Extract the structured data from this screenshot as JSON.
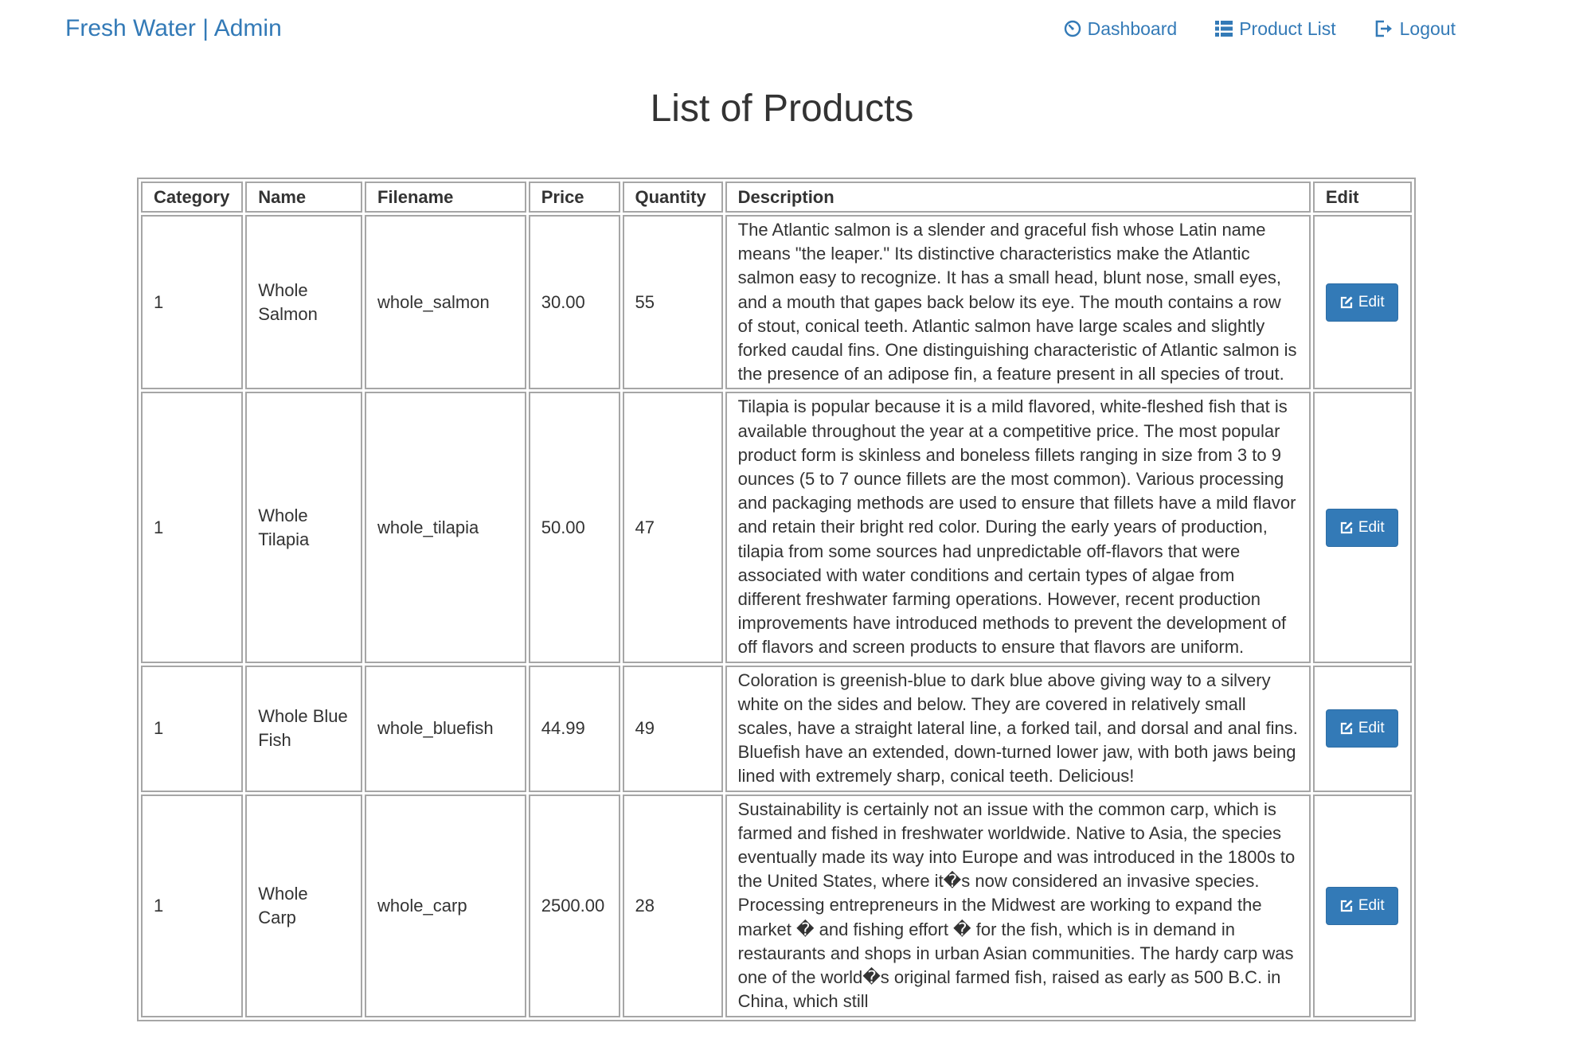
{
  "navbar": {
    "brand": "Fresh Water | Admin",
    "links": [
      {
        "label": "Dashboard",
        "icon": "dashboard-icon"
      },
      {
        "label": "Product List",
        "icon": "list-icon"
      },
      {
        "label": "Logout",
        "icon": "logout-icon"
      }
    ]
  },
  "page": {
    "title": "List of Products"
  },
  "table": {
    "headers": [
      "Category",
      "Name",
      "Filename",
      "Price",
      "Quantity",
      "Description",
      "Edit"
    ],
    "rows": [
      {
        "category": "1",
        "name": "Whole Salmon",
        "filename": "whole_salmon",
        "price": "30.00",
        "quantity": "55",
        "description": "The Atlantic salmon is a slender and graceful fish whose Latin name means \"the leaper.\" Its distinctive characteristics make the Atlantic salmon easy to recognize. It has a small head, blunt nose, small eyes, and a mouth that gapes back below its eye. The mouth contains a row of stout, conical teeth. Atlantic salmon have large scales and slightly forked caudal fins. One distinguishing characteristic of Atlantic salmon is the presence of an adipose fin, a feature present in all species of trout.",
        "edit_label": "Edit"
      },
      {
        "category": "1",
        "name": "Whole Tilapia",
        "filename": "whole_tilapia",
        "price": "50.00",
        "quantity": "47",
        "description": "Tilapia is popular because it is a mild flavored, white-fleshed fish that is available throughout the year at a competitive price. The most popular product form is skinless and boneless fillets ranging in size from 3 to 9 ounces (5 to 7 ounce fillets are the most common). Various processing and packaging methods are used to ensure that fillets have a mild flavor and retain their bright red color. During the early years of production, tilapia from some sources had unpredictable off-flavors that were associated with water conditions and certain types of algae from different freshwater farming operations. However, recent production improvements have introduced methods to prevent the development of off flavors and screen products to ensure that flavors are uniform.",
        "edit_label": "Edit"
      },
      {
        "category": "1",
        "name": "Whole Blue Fish",
        "filename": "whole_bluefish",
        "price": "44.99",
        "quantity": "49",
        "description": "Coloration is greenish-blue to dark blue above giving way to a silvery white on the sides and below. They are covered in relatively small scales, have a straight lateral line, a forked tail, and dorsal and anal fins. Bluefish have an extended, down-turned lower jaw, with both jaws being lined with extremely sharp, conical teeth. Delicious!",
        "edit_label": "Edit"
      },
      {
        "category": "1",
        "name": "Whole Carp",
        "filename": "whole_carp",
        "price": "2500.00",
        "quantity": "28",
        "description": "Sustainability is certainly not an issue with the common carp, which is farmed and fished in freshwater worldwide. Native to Asia, the species eventually made its way into Europe and was introduced in the 1800s to the United States, where it�s now considered an invasive species. Processing entrepreneurs in the Midwest are working to expand the market � and fishing effort � for the fish, which is in demand in restaurants and shops in urban Asian communities. The hardy carp was one of the world�s original farmed fish, raised as early as 500 B.C. in China, which still",
        "edit_label": "Edit"
      }
    ]
  },
  "colors": {
    "link": "#337ab7",
    "button_bg": "#337ab7",
    "button_text": "#ffffff",
    "border": "#a6a6a6",
    "text": "#333333"
  }
}
